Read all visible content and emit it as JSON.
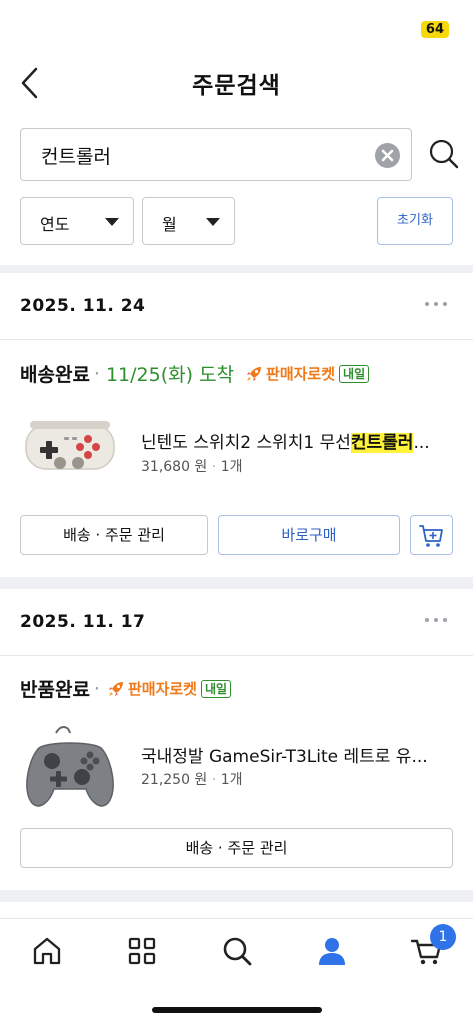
{
  "status_bar": {
    "battery": "64"
  },
  "header": {
    "title": "주문검색"
  },
  "search": {
    "value": "컨트롤러"
  },
  "filters": {
    "year_label": "연도",
    "month_label": "월",
    "reset_label": "초기화"
  },
  "orders": [
    {
      "date": "2025. 11. 24",
      "status": "배송완료",
      "separator": "·",
      "arrival": "11/25(화) 도착",
      "badge": "판매자로켓",
      "badge_tag": "내일",
      "product_name_prefix": "닌텐도 스위치2 스위치1 무선",
      "product_name_highlight": "컨트롤러",
      "product_name_suffix": "...",
      "price": "31,680 원",
      "qty_sep": "·",
      "quantity": "1개",
      "manage_label": "배송 · 주문 관리",
      "buy_now_label": "바로구매"
    },
    {
      "date": "2025. 11. 17",
      "status": "반품완료",
      "separator": "·",
      "badge": "판매자로켓",
      "badge_tag": "내일",
      "product_name": "국내정발 GameSir-T3Lite 레트로 유...",
      "price": "21,250 원",
      "qty_sep": "·",
      "quantity": "1개",
      "manage_label": "배송 · 주문 관리"
    }
  ],
  "bottom_nav": {
    "cart_count": "1",
    "active": "my",
    "accent": "#2f73e8"
  },
  "colors": {
    "accent_blue": "#2d62c8",
    "rocket_orange": "#f07a19",
    "delivery_green": "#2f8f2f",
    "highlight": "#fff23a"
  },
  "icons": [
    "back-chevron-icon",
    "clear-icon",
    "search-icon",
    "caret-down-icon",
    "more-icon",
    "rocket-icon",
    "cart-add-icon",
    "home-icon",
    "category-icon",
    "search-icon",
    "person-icon",
    "cart-icon"
  ]
}
